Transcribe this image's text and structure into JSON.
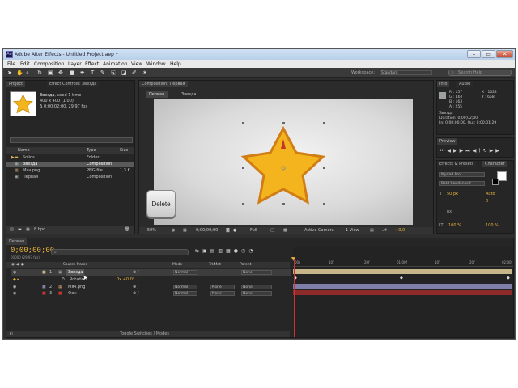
{
  "window": {
    "title": "Adobe After Effects - Untitled Project.aep *",
    "app_icon": "Ae"
  },
  "menu": [
    "File",
    "Edit",
    "Composition",
    "Layer",
    "Effect",
    "Animation",
    "View",
    "Window",
    "Help"
  ],
  "toolbar": {
    "workspace_label": "Workspace:",
    "workspace_value": "Standard",
    "search_placeholder": "Search Help"
  },
  "project": {
    "tab": "Project",
    "tab2": "Effect Controls: Звезда",
    "selected_name": "Звезда",
    "selected_used": ", used 1 time",
    "selected_dims": "400 x 400 (1,00)",
    "selected_time": "Δ 0;00;02;00, 29,97 fps",
    "columns": {
      "name": "Name",
      "type": "Type",
      "size": "Size"
    },
    "items": [
      {
        "name": "Solids",
        "type": "Folder",
        "size": ""
      },
      {
        "name": "Звезда",
        "type": "Composition",
        "size": ""
      },
      {
        "name": "Мяч.png",
        "type": "PNG file",
        "size": "1,3 K"
      },
      {
        "name": "Первая",
        "type": "Composition",
        "size": ""
      }
    ],
    "bpc": "8 bpc"
  },
  "composition": {
    "tab": "Composition: Первая",
    "sub_tabs": [
      "Первая",
      "Звезда"
    ],
    "zoom": "50%",
    "timecode": "0;00;00;00",
    "resolution": "Full",
    "camera": "Active Camera",
    "view": "1 View",
    "exposure": "+0,0",
    "delete_key": "Delete"
  },
  "info": {
    "tab": "Info",
    "tab2": "Audio",
    "r": "R : 157",
    "g": "G : 162",
    "b": "B : 163",
    "a": "A : 255",
    "x": "X : 1022",
    "y": "Y : 658",
    "layer": "Звезда",
    "duration": "Duration: 0;00;02;00",
    "inout": "In: 0;00;00;00, Out: 0;00;01;29"
  },
  "preview": {
    "tab": "Preview"
  },
  "effects": {
    "tab": "Effects & Presets",
    "tab2": "Character",
    "font": "Myriad Pro",
    "style": "Bold Condensed",
    "size": "50 px",
    "leading": "Auto",
    "tracking": "0",
    "unit": "px",
    "scale_v": "100 %",
    "scale_h": "100 %"
  },
  "timeline": {
    "tab": "Первая",
    "timecode": "0;00;00;00",
    "fps": "00000 (29.97 fps)",
    "search_placeholder": "",
    "columns": {
      "source": "Source Name",
      "mode": "Mode",
      "trkmat": "TrkMat",
      "parent": "Parent"
    },
    "layers": [
      {
        "num": "1",
        "name": "Звезда",
        "mode": "Normal",
        "trkmat": "",
        "parent": "None",
        "color": "#c7b58a"
      },
      {
        "num": "",
        "name": "Rotation",
        "value": "0x +0,0°",
        "mode": "",
        "trkmat": "",
        "parent": "",
        "color": ""
      },
      {
        "num": "2",
        "name": "Мяч.png",
        "mode": "Normal",
        "trkmat": "None",
        "parent": "None",
        "color": "#7e7ea8"
      },
      {
        "num": "3",
        "name": "Фон",
        "mode": "Normal",
        "trkmat": "None",
        "parent": "None",
        "color": "#8e2a2a"
      }
    ],
    "ruler": [
      "00s",
      "05f",
      "10f",
      "15f",
      "20f",
      "25f",
      "01:00f",
      "05f",
      "10f",
      "15f",
      "20f",
      "25f",
      "02:00f"
    ],
    "toggle_label": "Toggle Switches / Modes"
  }
}
